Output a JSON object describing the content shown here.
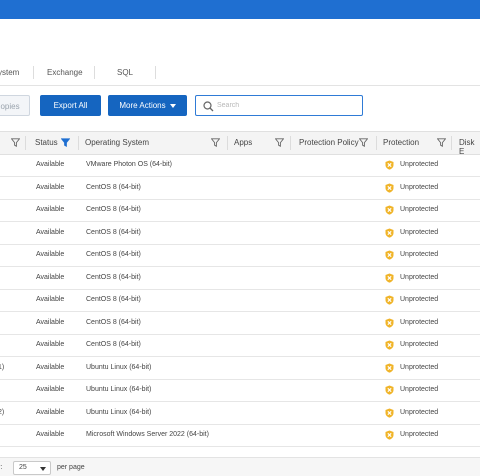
{
  "colors": {
    "brand": "#1f6fd1",
    "primary_button": "#1565c0",
    "search_border": "#2f7bd6",
    "unprotected_icon": "#f0b429"
  },
  "tabs": [
    {
      "label": "ystem"
    },
    {
      "label": "Exchange"
    },
    {
      "label": "SQL"
    }
  ],
  "toolbar": {
    "copies_label": "opies",
    "export_label": "Export All",
    "more_label": "More Actions",
    "more_icon": "caret-down-icon",
    "search_placeholder": "Search",
    "search_icon": "search-icon"
  },
  "columns": [
    {
      "label": "",
      "filter_active": false
    },
    {
      "label": "Status",
      "filter_active": true
    },
    {
      "label": "Operating System",
      "filter_active": false
    },
    {
      "label": "Apps",
      "filter_active": false
    },
    {
      "label": "Protection Policy",
      "filter_active": false
    },
    {
      "label": "Protection",
      "filter_active": false
    },
    {
      "label": "Disk E",
      "filter_active": false
    }
  ],
  "rows": [
    {
      "name": "",
      "status": "Available",
      "os": "VMware Photon OS (64-bit)",
      "protection": "Unprotected"
    },
    {
      "name": "",
      "status": "Available",
      "os": "CentOS 8 (64-bit)",
      "protection": "Unprotected"
    },
    {
      "name": "",
      "status": "Available",
      "os": "CentOS 8 (64-bit)",
      "protection": "Unprotected"
    },
    {
      "name": "",
      "status": "Available",
      "os": "CentOS 8 (64-bit)",
      "protection": "Unprotected"
    },
    {
      "name": "",
      "status": "Available",
      "os": "CentOS 8 (64-bit)",
      "protection": "Unprotected"
    },
    {
      "name": "",
      "status": "Available",
      "os": "CentOS 8 (64-bit)",
      "protection": "Unprotected"
    },
    {
      "name": "",
      "status": "Available",
      "os": "CentOS 8 (64-bit)",
      "protection": "Unprotected"
    },
    {
      "name": "",
      "status": "Available",
      "os": "CentOS 8 (64-bit)",
      "protection": "Unprotected"
    },
    {
      "name": "",
      "status": "Available",
      "os": "CentOS 8 (64-bit)",
      "protection": "Unprotected"
    },
    {
      "name": "1)",
      "status": "Available",
      "os": "Ubuntu Linux (64-bit)",
      "protection": "Unprotected"
    },
    {
      "name": ")",
      "status": "Available",
      "os": "Ubuntu Linux (64-bit)",
      "protection": "Unprotected"
    },
    {
      "name": "2)",
      "status": "Available",
      "os": "Ubuntu Linux (64-bit)",
      "protection": "Unprotected"
    },
    {
      "name": "",
      "status": "Available",
      "os": "Microsoft Windows Server 2022 (64-bit)",
      "protection": "Unprotected"
    }
  ],
  "pager": {
    "prefix": "r:",
    "page_size": "25",
    "suffix": "per page"
  }
}
